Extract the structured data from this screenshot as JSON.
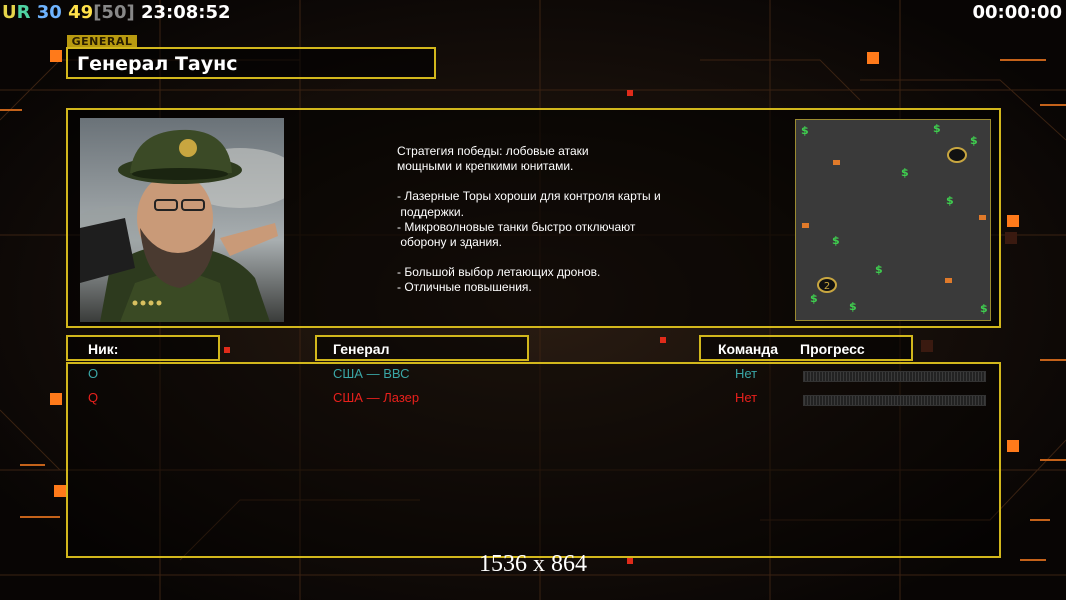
{
  "hud": {
    "ur_u": "U",
    "ur_r": "R",
    "fps": "30",
    "ping": "49",
    "max": "[50]",
    "clock": "23:08:52",
    "timer": "00:00:00"
  },
  "general_tag": "GENERAL",
  "general_name": "Генерал Таунс",
  "description": [
    "Стратегия победы: лобовые атаки",
    "мощными и крепкими юнитами.",
    "",
    "- Лазерные Торы хороши для контроля карты и",
    " поддержки.",
    "- Микроволновые танки быстро отключают",
    " оборону и здания.",
    "",
    "- Большой выбор летающих дронов.",
    "- Отличные повышения."
  ],
  "minimap": {
    "player2_label": "2"
  },
  "headers": {
    "nick": "Ник:",
    "general": "Генерал",
    "team": "Команда",
    "progress": "Прогресс"
  },
  "players": [
    {
      "nick": "O",
      "general": "США — ВВС",
      "team": "Нет",
      "color": "#3aa6a6",
      "progress": 0
    },
    {
      "nick": "Q",
      "general": "США — Лазер",
      "team": "Нет",
      "color": "#e8201c",
      "progress": 0
    }
  ],
  "resolution": "1536 x 864",
  "colors": {
    "frame": "#d2b71c",
    "accent": "#ff8a1c"
  }
}
